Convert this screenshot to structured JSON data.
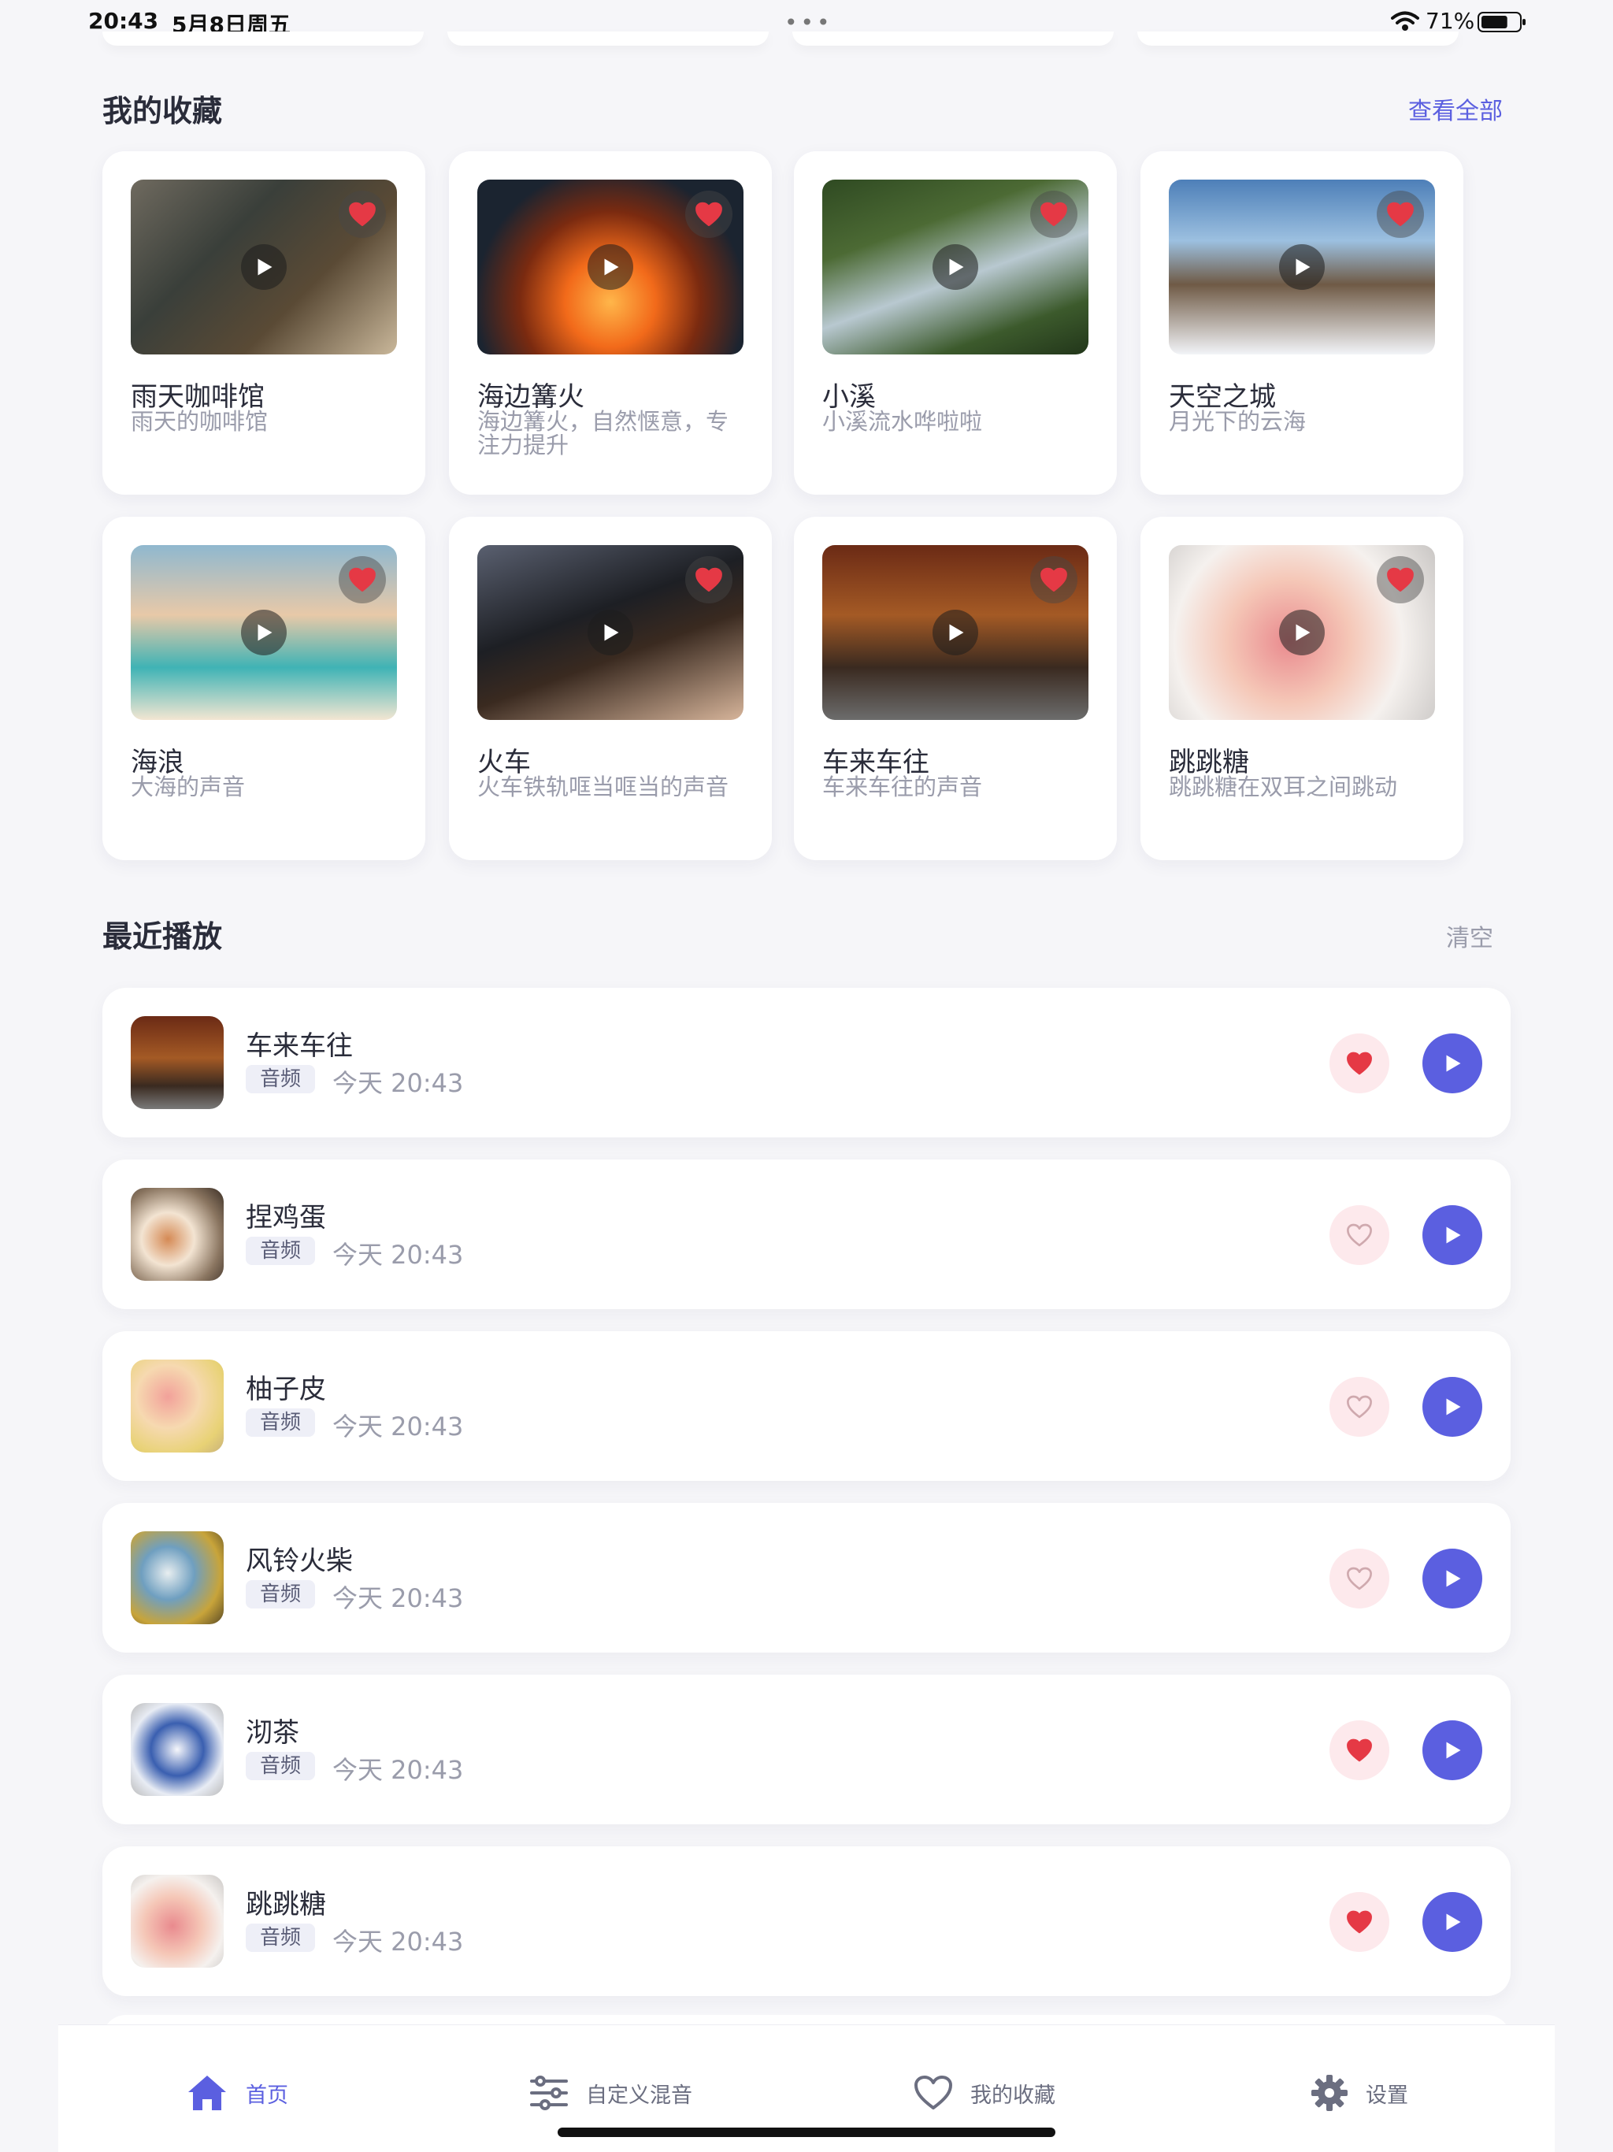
{
  "status": {
    "time": "20:43",
    "date": "5月8日周五",
    "battery": "71%",
    "battery_level": 0.71
  },
  "favorites": {
    "title": "我的收藏",
    "view_all": "查看全部",
    "items": [
      {
        "title": "雨天咖啡馆",
        "subtitle": "雨天的咖啡馆",
        "favorited": true
      },
      {
        "title": "海边篝火",
        "subtitle": "海边篝火，自然惬意，专注力提升",
        "favorited": true
      },
      {
        "title": "小溪",
        "subtitle": "小溪流水哗啦啦",
        "favorited": true
      },
      {
        "title": "天空之城",
        "subtitle": "月光下的云海",
        "favorited": true
      },
      {
        "title": "海浪",
        "subtitle": "大海的声音",
        "favorited": true
      },
      {
        "title": "火车",
        "subtitle": "火车铁轨哐当哐当的声音",
        "favorited": true
      },
      {
        "title": "车来车往",
        "subtitle": "车来车往的声音",
        "favorited": true
      },
      {
        "title": "跳跳糖",
        "subtitle": "跳跳糖在双耳之间跳动",
        "favorited": true
      }
    ]
  },
  "recent": {
    "title": "最近播放",
    "clear": "清空",
    "items": [
      {
        "title": "车来车往",
        "tag": "音频",
        "time": "今天 20:43",
        "favorited": true
      },
      {
        "title": "捏鸡蛋",
        "tag": "音频",
        "time": "今天 20:43",
        "favorited": false
      },
      {
        "title": "柚子皮",
        "tag": "音频",
        "time": "今天 20:43",
        "favorited": false
      },
      {
        "title": "风铃火柴",
        "tag": "音频",
        "time": "今天 20:43",
        "favorited": false
      },
      {
        "title": "沏茶",
        "tag": "音频",
        "time": "今天 20:43",
        "favorited": true
      },
      {
        "title": "跳跳糖",
        "tag": "音频",
        "time": "今天 20:43",
        "favorited": true
      }
    ]
  },
  "tabs": [
    {
      "label": "首页",
      "icon": "home-icon",
      "active": true
    },
    {
      "label": "自定义混音",
      "icon": "sliders-icon",
      "active": false
    },
    {
      "label": "我的收藏",
      "icon": "heart-outline-icon",
      "active": false
    },
    {
      "label": "设置",
      "icon": "gear-icon",
      "active": false
    }
  ],
  "colors": {
    "accent": "#5b5fe0",
    "heart": "#e53945",
    "heart_bg": "#fde9ec"
  }
}
